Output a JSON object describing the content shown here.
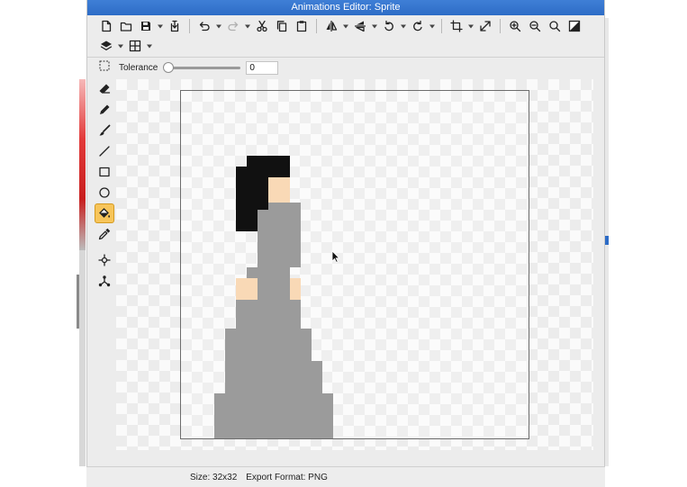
{
  "window": {
    "title": "Animations Editor: Sprite"
  },
  "toolbar_rows": [
    [
      {
        "name": "new-file-icon",
        "type": "btn"
      },
      {
        "name": "open-folder-icon",
        "type": "btn"
      },
      {
        "name": "save-icon",
        "type": "btn"
      },
      {
        "name": "save-dropdown",
        "type": "drop"
      },
      {
        "name": "export-icon",
        "type": "btn"
      },
      {
        "name": "sep",
        "type": "sep"
      },
      {
        "name": "undo-icon",
        "type": "btn"
      },
      {
        "name": "undo-dropdown",
        "type": "drop"
      },
      {
        "name": "redo-icon",
        "type": "btn",
        "disabled": true
      },
      {
        "name": "redo-dropdown",
        "type": "drop"
      },
      {
        "name": "cut-icon",
        "type": "btn"
      },
      {
        "name": "copy-icon",
        "type": "btn"
      },
      {
        "name": "paste-icon",
        "type": "btn"
      },
      {
        "name": "sep",
        "type": "sep"
      },
      {
        "name": "flip-horizontal-icon",
        "type": "btn"
      },
      {
        "name": "flip-horizontal-dropdown",
        "type": "drop"
      },
      {
        "name": "flip-vertical-icon",
        "type": "btn"
      },
      {
        "name": "flip-vertical-dropdown",
        "type": "drop"
      },
      {
        "name": "rotate-left-icon",
        "type": "btn"
      },
      {
        "name": "rotate-left-dropdown",
        "type": "drop"
      },
      {
        "name": "rotate-right-icon",
        "type": "btn"
      },
      {
        "name": "rotate-right-dropdown",
        "type": "drop"
      },
      {
        "name": "sep",
        "type": "sep"
      },
      {
        "name": "crop-icon",
        "type": "btn"
      },
      {
        "name": "crop-dropdown",
        "type": "drop"
      },
      {
        "name": "resize-icon",
        "type": "btn"
      },
      {
        "name": "sep",
        "type": "sep"
      },
      {
        "name": "zoom-in-icon",
        "type": "btn"
      },
      {
        "name": "zoom-out-icon",
        "type": "btn"
      },
      {
        "name": "zoom-fit-icon",
        "type": "btn"
      },
      {
        "name": "toggle-transparency-icon",
        "type": "btn"
      }
    ],
    [
      {
        "name": "layers-icon",
        "type": "btn"
      },
      {
        "name": "layers-dropdown",
        "type": "drop"
      },
      {
        "name": "grid-icon",
        "type": "btn"
      },
      {
        "name": "grid-dropdown",
        "type": "drop"
      }
    ]
  ],
  "options": {
    "tolerance_label": "Tolerance",
    "tolerance_value": "0",
    "tolerance_level": 0
  },
  "tools": [
    {
      "name": "eraser-icon",
      "active": false
    },
    {
      "name": "pencil-icon",
      "active": false
    },
    {
      "name": "brush-icon",
      "active": false
    },
    {
      "name": "line-icon",
      "active": false
    },
    {
      "name": "rectangle-icon",
      "active": false
    },
    {
      "name": "ellipse-icon",
      "active": false
    },
    {
      "name": "fill-bucket-icon",
      "active": true
    },
    {
      "name": "color-picker-icon",
      "active": false
    },
    {
      "name": "gap"
    },
    {
      "name": "origin-icon",
      "active": false
    },
    {
      "name": "collision-mask-icon",
      "active": false
    }
  ],
  "colors": {
    "hair": "#111111",
    "skin": "#f9d9b6",
    "dress": "#9b9b9b",
    "active_tool": "#f7c55a"
  },
  "status": {
    "size": "Size: 32x32",
    "export_format": "Export Format: PNG"
  }
}
